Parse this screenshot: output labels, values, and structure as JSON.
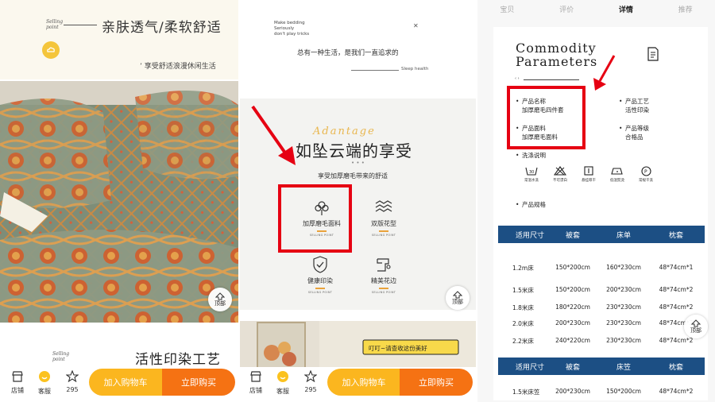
{
  "panel1": {
    "script_text": "Selling point",
    "title": "亲肤透气/柔软舒适",
    "subtitle": "享受舒适浪漫休闲生活",
    "script_text2": "Selling point",
    "title2": "活性印染工艺"
  },
  "panel2": {
    "intro_lines": [
      "Make bedding",
      "Seriously",
      "don't play tricks"
    ],
    "quote": "总有一种生活，是我们一直追求的",
    "sleep_label": "Sleep health",
    "advantage": "Adantage",
    "heading": "如坠云端的享受",
    "dots": "• • •",
    "sub": "享受加厚磨毛带来的舒适",
    "features": [
      {
        "label": "加厚磨毛面料",
        "sp": "SELLING POINT",
        "icon": "cotton-flower-icon"
      },
      {
        "label": "双版花型",
        "sp": "SELLING POINT",
        "icon": "wave-pattern-icon"
      },
      {
        "label": "健康印染",
        "sp": "SELLING POINT",
        "icon": "shield-check-icon"
      },
      {
        "label": "精美花边",
        "sp": "SELLING POINT",
        "icon": "sewing-machine-icon"
      }
    ],
    "bubble": "叮叮~请查收这份美好"
  },
  "panel3": {
    "tabs": [
      "宝贝",
      "评价",
      "详情",
      "推荐"
    ],
    "active_tab": "详情",
    "title_line1": "Commodity",
    "title_line2": "Parameters",
    "arrows": "‹ ›",
    "params": {
      "name_label": "产品名称",
      "name_value": "加厚磨毛四件套",
      "fabric_label": "产品面料",
      "fabric_value": "加厚磨毛面料",
      "craft_label": "产品工艺",
      "craft_value": "活性印染",
      "grade_label": "产品等级",
      "grade_value": "合格品"
    },
    "wash_label": "洗涤说明",
    "wash_items": [
      {
        "label": "常温水洗",
        "glyph": "30"
      },
      {
        "label": "不可漂白",
        "glyph": "✕"
      },
      {
        "label": "悬挂晾干",
        "glyph": "|"
      },
      {
        "label": "低温熨烫",
        "glyph": "·"
      },
      {
        "label": "常规干洗",
        "glyph": "P"
      }
    ],
    "spec_label": "产品规格",
    "table1_headers": [
      "适用尺寸",
      "被套",
      "床单",
      "枕套"
    ],
    "table1_rows": [
      [
        "1.2m床",
        "150*200cm",
        "160*230cm",
        "48*74cm*1"
      ],
      [
        "1.5米床",
        "150*200cm",
        "200*230cm",
        "48*74cm*2"
      ],
      [
        "1.8米床",
        "180*220cm",
        "230*230cm",
        "48*74cm*2"
      ],
      [
        "2.0米床",
        "200*230cm",
        "230*230cm",
        "48*74cm*2"
      ],
      [
        "2.2米床",
        "240*220cm",
        "230*230cm",
        "48*74cm*2"
      ]
    ],
    "table2_headers": [
      "适用尺寸",
      "被套",
      "床笠",
      "枕套"
    ],
    "table2_rows": [
      [
        "1.5米床笠",
        "200*230cm",
        "150*200cm",
        "48*74cm*2"
      ]
    ]
  },
  "common": {
    "back_to_top": "顶部",
    "store": "店铺",
    "service": "客服",
    "favorites_count": "295",
    "add_to_cart": "加入购物车",
    "buy_now": "立即购买"
  },
  "colors": {
    "highlight_red": "#e60012",
    "table_header_blue": "#1c4f84",
    "cart_yellow": "#fbb61f",
    "buy_orange": "#f57213",
    "accent_gold": "#e9b64d"
  }
}
